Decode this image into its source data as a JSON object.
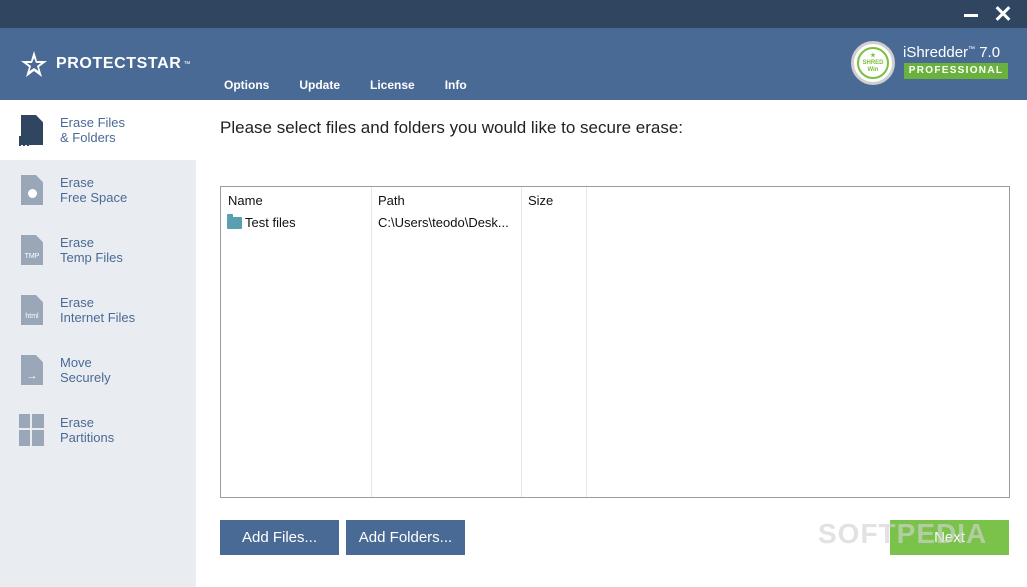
{
  "window": {
    "minimize_icon": "minimize-icon",
    "close_icon": "close-icon"
  },
  "header": {
    "brand": "PROTECTSTAR",
    "brand_tm": "™",
    "menu": [
      {
        "label": "Options"
      },
      {
        "label": "Update"
      },
      {
        "label": "License"
      },
      {
        "label": "Info"
      }
    ],
    "badge": {
      "line1": "SHRED",
      "line2": "Win"
    },
    "product": {
      "name": "iShredder",
      "tm": "™",
      "version": "7.0",
      "edition": "PROFESSIONAL"
    }
  },
  "sidebar": {
    "items": [
      {
        "line1": "Erase Files",
        "line2": "& Folders",
        "icon": "erase-files-icon",
        "active": true
      },
      {
        "line1": "Erase",
        "line2": "Free Space",
        "icon": "free-space-icon",
        "active": false
      },
      {
        "line1": "Erase",
        "line2": "Temp Files",
        "icon": "temp-files-icon",
        "icon_text": "TMP",
        "active": false
      },
      {
        "line1": "Erase",
        "line2": "Internet Files",
        "icon": "internet-files-icon",
        "icon_text": "html",
        "active": false
      },
      {
        "line1": "Move",
        "line2": "Securely",
        "icon": "move-securely-icon",
        "icon_text": "→",
        "active": false
      },
      {
        "line1": "Erase",
        "line2": "Partitions",
        "icon": "partitions-icon",
        "active": false
      }
    ]
  },
  "main": {
    "prompt": "Please select files and folders you would like to secure erase:",
    "table": {
      "columns": [
        "Name",
        "Path",
        "Size"
      ],
      "rows": [
        {
          "name": "Test files",
          "path": "C:\\Users\\teodo\\Desk...",
          "size": ""
        }
      ]
    },
    "buttons": {
      "add_files": "Add Files...",
      "add_folders": "Add Folders...",
      "next": "Next"
    },
    "watermark": "SOFTPEDIA"
  },
  "colors": {
    "titlebar": "#2f4560",
    "header": "#4a6a96",
    "sidebar": "#e9edf2",
    "accent_green": "#7ac24a"
  }
}
